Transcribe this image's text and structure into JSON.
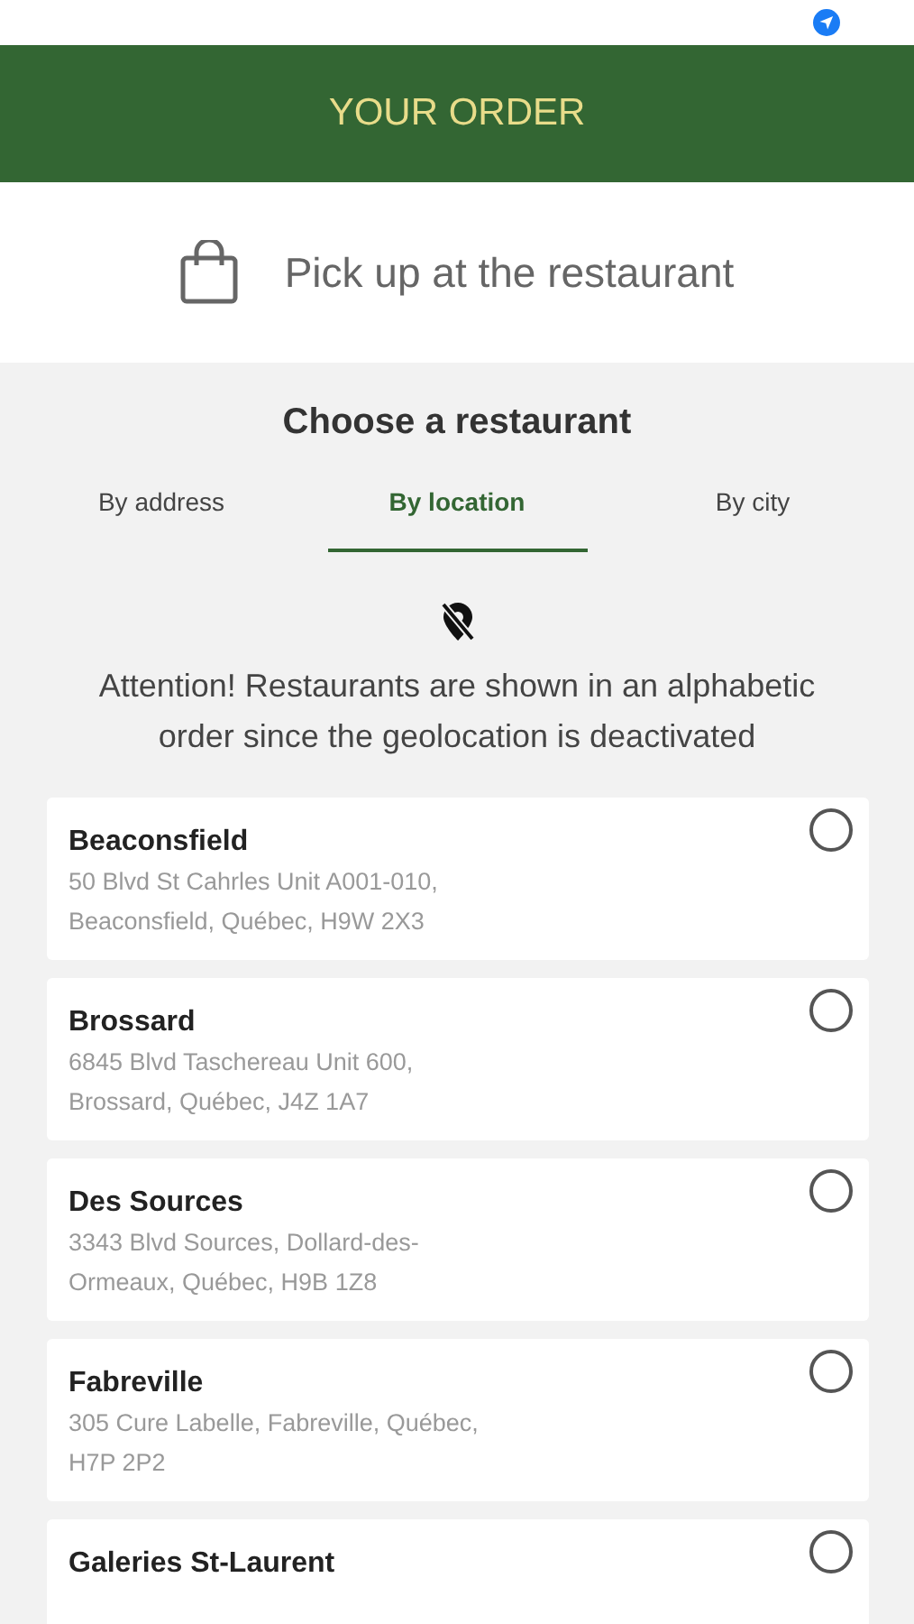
{
  "header": {
    "title": "YOUR ORDER"
  },
  "pickup": {
    "label": "Pick up at the restaurant"
  },
  "chooser": {
    "title": "Choose a restaurant",
    "tabs": [
      {
        "label": "By address",
        "selected": false
      },
      {
        "label": "By location",
        "selected": true
      },
      {
        "label": "By city",
        "selected": false
      }
    ],
    "notice": "Attention! Restaurants are shown in an alphabetic order since the geolocation is deactivated"
  },
  "restaurants": [
    {
      "name": "Beaconsfield",
      "address": "50 Blvd St Cahrles Unit A001-010, Beaconsfield, Québec, H9W 2X3",
      "selected": false
    },
    {
      "name": "Brossard",
      "address": "6845 Blvd Taschereau Unit 600, Brossard, Québec, J4Z 1A7",
      "selected": false
    },
    {
      "name": "Des Sources",
      "address": "3343 Blvd Sources, Dollard-des-Ormeaux, Québec, H9B 1Z8",
      "selected": false
    },
    {
      "name": "Fabreville",
      "address": "305 Cure Labelle, Fabreville, Québec, H7P 2P2",
      "selected": false
    },
    {
      "name": "Galeries St-Laurent",
      "selected": false
    }
  ]
}
